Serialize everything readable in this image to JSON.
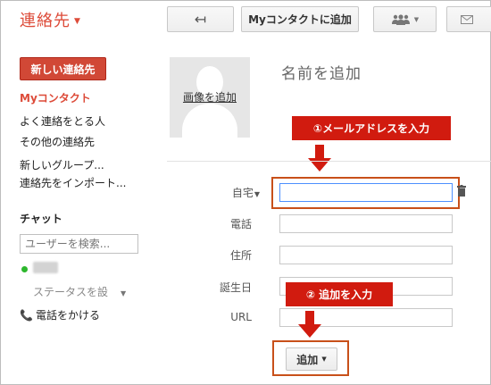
{
  "header": {
    "app_title": "連絡先",
    "back_icon": "↤",
    "add_to_my_contacts": "Myコンタクトに追加"
  },
  "sidebar": {
    "new_contact": "新しい連絡先",
    "items": [
      {
        "label": "Myコンタクト",
        "active": true
      },
      {
        "label": "よく連絡をとる人"
      },
      {
        "label": "その他の連絡先"
      },
      {
        "label": "新しいグループ..."
      },
      {
        "label": "連絡先をインポート..."
      }
    ],
    "chat": {
      "heading": "チャット",
      "search_placeholder": "ユーザーを検索...",
      "status": "ステータスを設",
      "call_phone": "電話をかける"
    }
  },
  "main": {
    "photo_label": "画像を追加",
    "name_placeholder": "名前を追加",
    "fields": {
      "home": "自宅",
      "phone": "電話",
      "address": "住所",
      "birthday": "誕生日",
      "url": "URL"
    },
    "add_button": "追加"
  },
  "annotations": {
    "step1": "①メールアドレスを入力",
    "step2": "② 追加を入力"
  },
  "colors": {
    "accent": "#dd4b39",
    "annotation_red": "#d11b0f",
    "annotation_border": "#c8501a"
  }
}
